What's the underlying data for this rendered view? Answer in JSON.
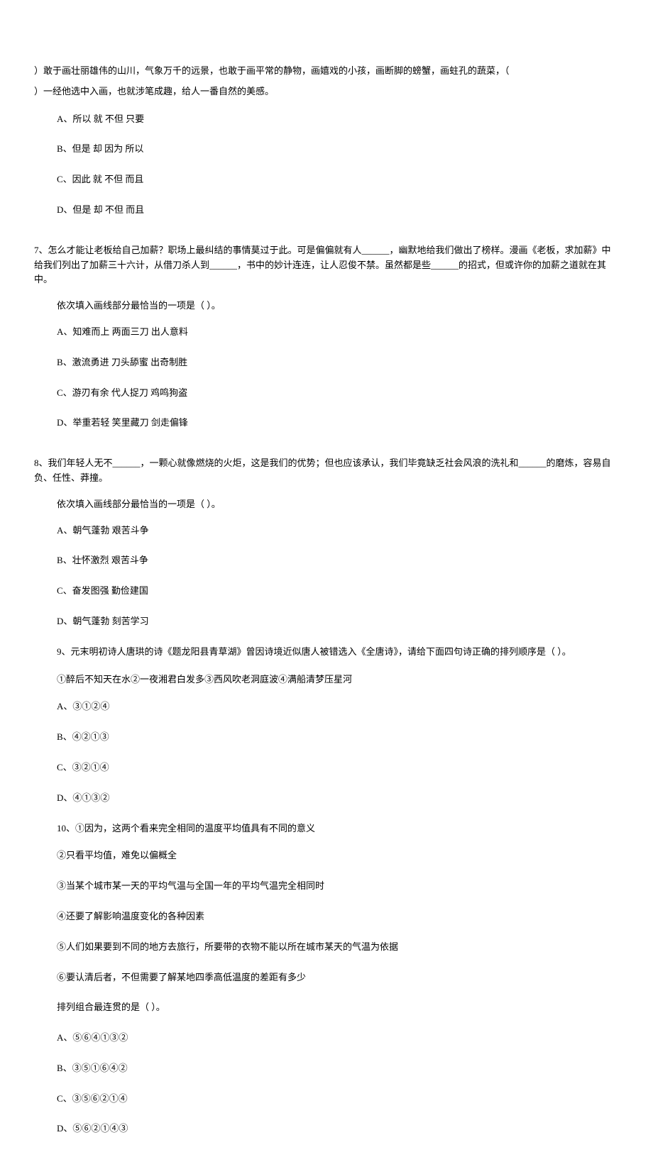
{
  "q6": {
    "intro_line1": "）敢于画壮丽雄伟的山川，气象万千的远景，也敢于画平常的静物，画嬉戏的小孩，画断脚的螃蟹，画蛀孔的蔬菜，（",
    "intro_line2": "）一经他选中入画，也就涉笔成趣，给人一番自然的美感。",
    "options": {
      "a": "A、所以 就 不但 只要",
      "b": "B、但是 却 因为 所以",
      "c": "C、因此 就 不但 而且",
      "d": "D、但是 却 不但 而且"
    }
  },
  "q7": {
    "intro": "7、怎么才能让老板给自己加薪？职场上最纠结的事情莫过于此。可是偏偏就有人______，幽默地给我们做出了榜样。漫画《老板，求加薪》中给我们列出了加薪三十六计，从借刀杀人到______，书中的妙计连连，让人忍俊不禁。虽然都是些______的招式，但或许你的加薪之道就在其中。",
    "prompt": "依次填入画线部分最恰当的一项是（  ）。",
    "options": {
      "a": "A、知难而上 两面三刀 出人意料",
      "b": "B、激流勇进 刀头舔蜜 出奇制胜",
      "c": "C、游刃有余 代人捉刀 鸡鸣狗盗",
      "d": "D、举重若轻 笑里藏刀 剑走偏锋"
    }
  },
  "q8": {
    "intro": "8、我们年轻人无不______，一颗心就像燃烧的火炬，这是我们的优势；但也应该承认，我们毕竟缺乏社会风浪的洗礼和______的磨炼，容易自负、任性、莽撞。",
    "prompt": "依次填入画线部分最恰当的一项是（  ）。",
    "options": {
      "a": "A、朝气蓬勃 艰苦斗争",
      "b": "B、壮怀激烈 艰苦斗争",
      "c": "C、奋发图强 勤俭建国",
      "d": "D、朝气蓬勃 刻苦学习"
    }
  },
  "q9": {
    "intro": "9、元末明初诗人唐珙的诗《题龙阳县青草湖》曾因诗境近似唐人被错选入《全唐诗》，请给下面四句诗正确的排列顺序是（    ）。",
    "poem": "①醉后不知天在水②一夜湘君白发多③西风吹老洞庭波④满船清梦压星河",
    "options": {
      "a": "A、③①②④",
      "b": "B、④②①③",
      "c": "C、③②①④",
      "d": "D、④①③②"
    }
  },
  "q10": {
    "intro": "10、①因为，这两个看来完全相同的温度平均值具有不同的意义",
    "items": {
      "i2": "②只看平均值，难免以偏概全",
      "i3": "③当某个城市某一天的平均气温与全国一年的平均气温完全相同时",
      "i4": "④还要了解影响温度变化的各种因素",
      "i5": "⑤人们如果要到不同的地方去旅行，所要带的衣物不能以所在城市某天的气温为依据",
      "i6": "⑥要认清后者，不但需要了解某地四季高低温度的差距有多少"
    },
    "prompt": "排列组合最连贯的是（    ）。",
    "options": {
      "a": "A、⑤⑥④①③②",
      "b": "B、③⑤①⑥④②",
      "c": "C、③⑤⑥②①④",
      "d": "D、⑤⑥②①④③"
    }
  }
}
